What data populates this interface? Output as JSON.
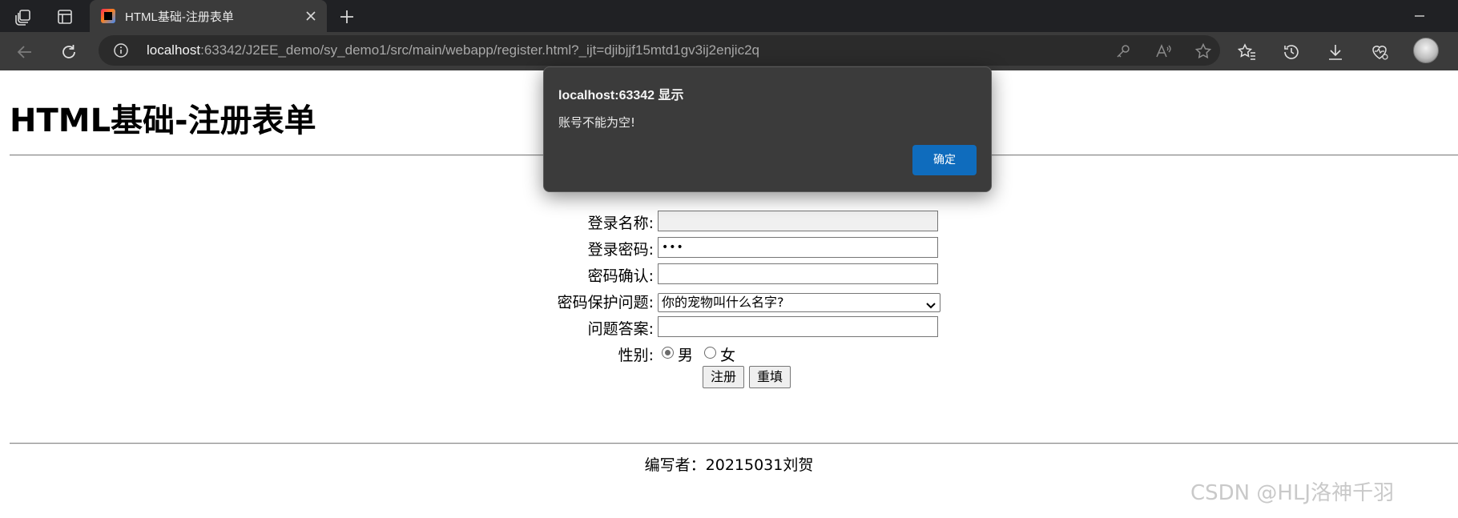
{
  "browser": {
    "tab_title": "HTML基础-注册表单",
    "url_host": "localhost",
    "url_rest": ":63342/J2EE_demo/sy_demo1/src/main/webapp/register.html?_ijt=djibjjf15mtd1gv3ij2enjic2q"
  },
  "page": {
    "heading": "HTML基础-注册表单",
    "form": {
      "login_name_label": "登录名称:",
      "login_name_value": "",
      "password_label": "登录密码:",
      "password_value": "•••",
      "confirm_label": "密码确认:",
      "confirm_value": "",
      "question_label": "密码保护问题:",
      "question_selected": "你的宠物叫什么名字?",
      "answer_label": "问题答案:",
      "answer_value": "",
      "gender_label": "性别:",
      "gender_options": [
        "男",
        "女"
      ],
      "gender_selected": "男",
      "submit_label": "注册",
      "reset_label": "重填"
    },
    "footer": "编写者：20215031刘贺",
    "watermark": "CSDN @HLJ洛神千羽"
  },
  "dialog": {
    "title": "localhost:63342 显示",
    "message": "账号不能为空!",
    "ok_label": "确定"
  },
  "colors": {
    "chrome_dark": "#202124",
    "toolbar": "#3b3b3b",
    "dialog_bg": "#3b3b3b",
    "accent": "#0f6cbd"
  }
}
